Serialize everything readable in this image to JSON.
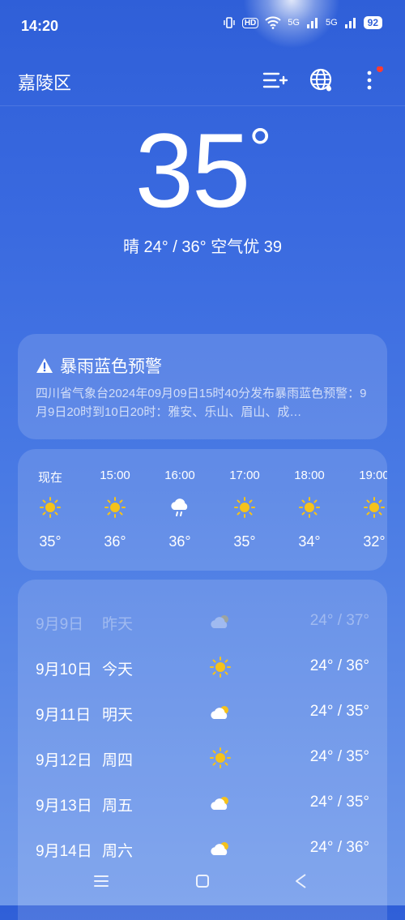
{
  "status": {
    "time": "14:20",
    "hd": "HD",
    "net1": "5G",
    "net2": "5G",
    "battery": "92"
  },
  "header": {
    "city": "嘉陵区"
  },
  "current": {
    "temp": "35",
    "deg": "°",
    "summary": "晴  24° / 36°  空气优 39"
  },
  "alert": {
    "title": "暴雨蓝色预警",
    "text": "四川省气象台2024年09月09日15时40分发布暴雨蓝色预警：9月9日20时到10日20时：雅安、乐山、眉山、成…"
  },
  "hourly": [
    {
      "label": "现在",
      "icon": "sun-icon",
      "temp": "35°"
    },
    {
      "label": "15:00",
      "icon": "sun-icon",
      "temp": "36°"
    },
    {
      "label": "16:00",
      "icon": "rain-cloud-icon",
      "temp": "36°"
    },
    {
      "label": "17:00",
      "icon": "sun-icon",
      "temp": "35°"
    },
    {
      "label": "18:00",
      "icon": "sun-icon",
      "temp": "34°"
    },
    {
      "label": "19:00",
      "icon": "sun-icon",
      "temp": "32°"
    }
  ],
  "daily": [
    {
      "date": "9月9日",
      "name": "昨天",
      "icon": "cloudy-icon",
      "temp": "24° / 37°"
    },
    {
      "date": "9月10日",
      "name": "今天",
      "icon": "sun-icon",
      "temp": "24° / 36°"
    },
    {
      "date": "9月11日",
      "name": "明天",
      "icon": "partly-cloudy-icon",
      "temp": "24° / 35°"
    },
    {
      "date": "9月12日",
      "name": "周四",
      "icon": "sun-icon",
      "temp": "24° / 35°"
    },
    {
      "date": "9月13日",
      "name": "周五",
      "icon": "partly-cloudy-icon",
      "temp": "24° / 35°"
    },
    {
      "date": "9月14日",
      "name": "周六",
      "icon": "partly-cloudy-icon",
      "temp": "24° / 36°"
    }
  ],
  "colors": {
    "sun": "#f5c21b",
    "background": "#3a6ae0",
    "badge": "#ff3b30"
  }
}
